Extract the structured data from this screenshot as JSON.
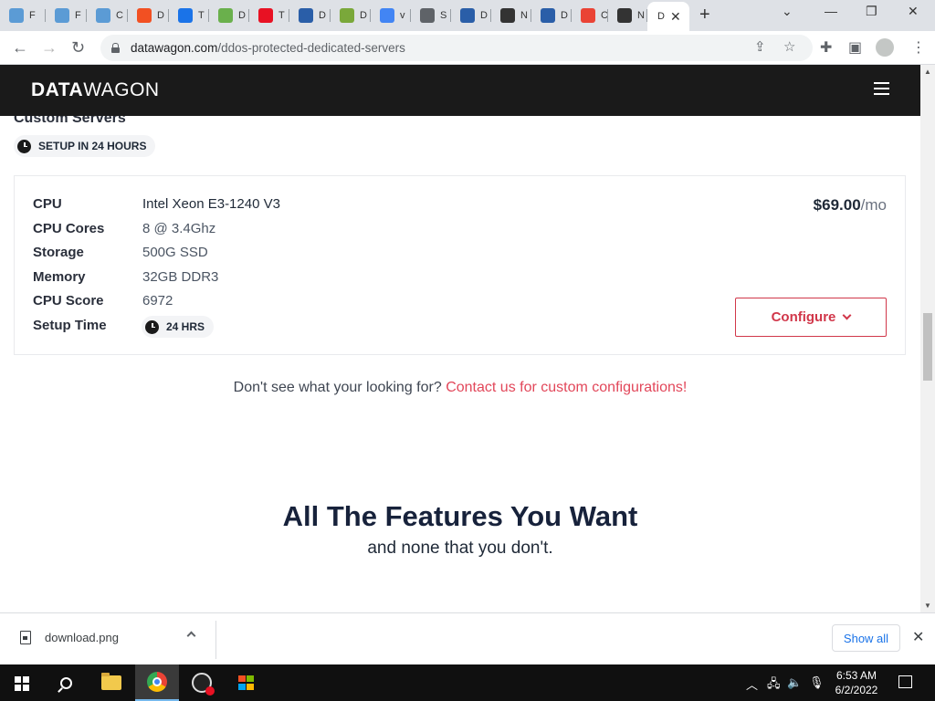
{
  "browser": {
    "tabs": [
      {
        "letter": "F",
        "icon": "sparkle-icon",
        "color": "#5b9bd5"
      },
      {
        "letter": "F",
        "icon": "sparkle-icon",
        "color": "#5b9bd5"
      },
      {
        "letter": "C",
        "icon": "sparkle-icon",
        "color": "#5b9bd5"
      },
      {
        "letter": "D",
        "icon": "microsoft-icon",
        "color": "#f25022"
      },
      {
        "letter": "T",
        "icon": "warning-icon",
        "color": "#1a73e8"
      },
      {
        "letter": "D",
        "icon": "map-icon",
        "color": "#6ab04c"
      },
      {
        "letter": "T",
        "icon": "opera-icon",
        "color": "#e81123"
      },
      {
        "letter": "D",
        "icon": "datawagon-icon",
        "color": "#2a5ea8"
      },
      {
        "letter": "D",
        "icon": "book-icon",
        "color": "#7aa83a"
      },
      {
        "letter": "v",
        "icon": "google-icon",
        "color": "#4285f4"
      },
      {
        "letter": "S",
        "icon": "globe-icon",
        "color": "#5f6368"
      },
      {
        "letter": "D",
        "icon": "datawagon-icon",
        "color": "#2a5ea8"
      },
      {
        "letter": "N",
        "icon": "github-icon",
        "color": "#333333"
      },
      {
        "letter": "D",
        "icon": "datawagon-icon",
        "color": "#2a5ea8"
      },
      {
        "letter": "C",
        "icon": "chrome-icon",
        "color": "#ea4335"
      },
      {
        "letter": "N",
        "icon": "github-icon",
        "color": "#333333"
      }
    ],
    "active_tab": {
      "letter": "D"
    },
    "url_host": "datawagon.com",
    "url_path": "/ddos-protected-dedicated-servers"
  },
  "site": {
    "logo_bold": "DATA",
    "logo_rest": "WAGON"
  },
  "section": {
    "title": "Custom Servers",
    "setup_badge": "SETUP IN 24 HOURS"
  },
  "server": {
    "specs": [
      {
        "label": "CPU",
        "value": "Intel Xeon E3-1240 V3"
      },
      {
        "label": "CPU Cores",
        "value": "8 @ 3.4Ghz"
      },
      {
        "label": "Storage",
        "value": "500G SSD"
      },
      {
        "label": "Memory",
        "value": "32GB DDR3"
      },
      {
        "label": "CPU Score",
        "value": "6972"
      },
      {
        "label": "Setup Time",
        "value": "24 HRS"
      }
    ],
    "price": "$69.00",
    "price_period": "/mo",
    "configure_label": "Configure"
  },
  "contact": {
    "prefix": "Don't see what your looking for?",
    "link": "Contact us for custom configurations!"
  },
  "features": {
    "title": "All The Features You Want",
    "subtitle": "and none that you don't."
  },
  "downloads": {
    "file_name": "download.png",
    "show_all": "Show all"
  },
  "taskbar": {
    "time": "6:53 AM",
    "date": "6/2/2022"
  },
  "colors": {
    "accent": "#d1374a",
    "header_bg": "#1a1a1a",
    "link": "#e2475a"
  }
}
